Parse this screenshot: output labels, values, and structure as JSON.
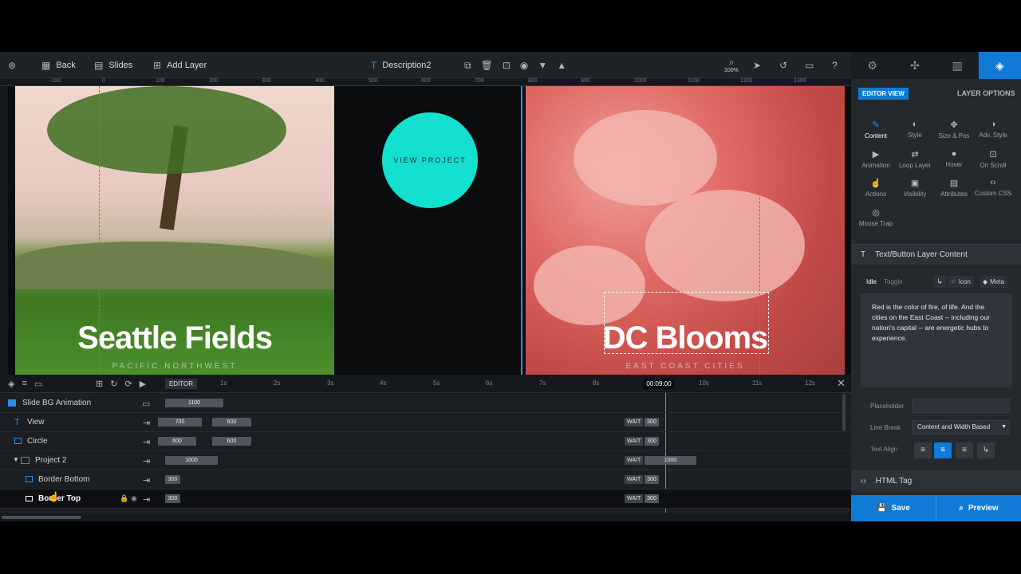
{
  "toolbar": {
    "back": "Back",
    "slides": "Slides",
    "add_layer": "Add Layer",
    "layer_name": "Description2",
    "zoom": "100%"
  },
  "ruler": [
    "-100",
    "0",
    "100",
    "200",
    "300",
    "400",
    "500",
    "600",
    "700",
    "800",
    "900",
    "1000",
    "1100",
    "1200",
    "1300"
  ],
  "slides": [
    {
      "title": "Seattle Fields",
      "subtitle": "PACIFIC NORTHWEST"
    },
    {
      "title": "DC Blooms",
      "subtitle": "EAST COAST CITIES"
    }
  ],
  "circle": {
    "label": "VIEW PROJECT",
    "color": "#13e0cf"
  },
  "timeline": {
    "editor_label": "EDITOR",
    "time_marker": "00:09:00",
    "ticks": [
      "1s",
      "2s",
      "3s",
      "4s",
      "5s",
      "6s",
      "7s",
      "8s",
      "9s",
      "10s",
      "11s",
      "12s"
    ],
    "rows": [
      {
        "name": "Slide BG Animation",
        "bars": [
          "1100"
        ],
        "wait": "",
        "end": ""
      },
      {
        "name": "View",
        "bars": [
          "700",
          "600"
        ],
        "wait": "WAIT",
        "end": "300"
      },
      {
        "name": "Circle",
        "bars": [
          "600",
          "600"
        ],
        "wait": "WAIT",
        "end": "300"
      },
      {
        "name": "Project 2",
        "bars": [
          "1000"
        ],
        "wait": "WAIT",
        "end": "1000"
      },
      {
        "name": "Border Bottom",
        "bars": [
          "300"
        ],
        "wait": "WAIT",
        "end": "300"
      },
      {
        "name": "Border Top",
        "bars": [
          "300"
        ],
        "wait": "WAIT",
        "end": "300"
      }
    ]
  },
  "panel": {
    "editor_view": "EDITOR VIEW",
    "layer_options": "LAYER OPTIONS",
    "grid": [
      "Content",
      "Style",
      "Size & Pos",
      "Adv. Style",
      "Animation",
      "Loop Layer",
      "Hover",
      "On Scroll",
      "Actions",
      "Visibility",
      "Attributes",
      "Custom CSS",
      "Mouse Trap"
    ],
    "section_title": "Text/Button Layer Content",
    "idle": "Idle",
    "toggle": "Toggle",
    "icon": "Icon",
    "meta": "Meta",
    "content_text": "Red is the color of fire, of life. And the cities on the East Coast -- including our nation's capital -- are energetic hubs to experience.",
    "placeholder_label": "Placeholder",
    "line_break_label": "Line Break",
    "line_break_value": "Content and Width Based",
    "text_align_label": "Text Align",
    "html_tag": "HTML Tag",
    "save": "Save",
    "preview": "Preview"
  }
}
